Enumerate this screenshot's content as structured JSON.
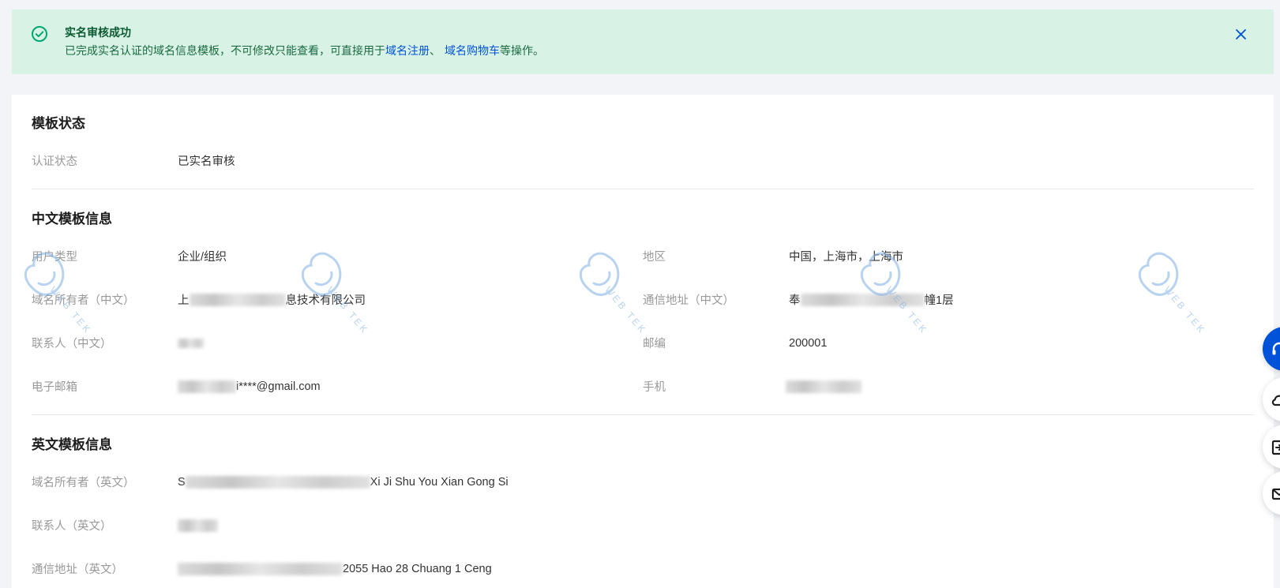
{
  "colors": {
    "page_bg": "#f3f4f7",
    "alert_bg": "#d8f3e5",
    "success": "#00a870",
    "link": "#0052d9",
    "label": "#999999",
    "value": "#333333"
  },
  "alert": {
    "type": "success",
    "icon": "check-circle-icon",
    "title": "实名审核成功",
    "text_before": "已完成实名认证的域名信息模板，不可修改只能查看，可直接用于",
    "link_register": "域名注册",
    "separator": "、",
    "link_cart": "域名购物车",
    "text_after": "等操作。",
    "close_icon": "close-icon"
  },
  "template_status": {
    "title": "模板状态",
    "auth_status": {
      "label": "认证状态",
      "value": "已实名审核"
    }
  },
  "chinese_template": {
    "title": "中文模板信息",
    "user_type": {
      "label": "用户类型",
      "value": "企业/组织"
    },
    "region": {
      "label": "地区",
      "value": "中国，上海市，上海市"
    },
    "owner": {
      "label": "域名所有者（中文）",
      "value_start": "上",
      "value_end": "息技术有限公司"
    },
    "address": {
      "label": "通信地址（中文）",
      "value_start": "奉",
      "value_end": "幢1层"
    },
    "contact": {
      "label": "联系人（中文）"
    },
    "postcode": {
      "label": "邮编",
      "value": "200001"
    },
    "email": {
      "label": "电子邮箱",
      "value_end": "i****@gmail.com"
    },
    "phone": {
      "label": "手机"
    }
  },
  "english_template": {
    "title": "英文模板信息",
    "owner": {
      "label": "域名所有者（英文）",
      "value_start": "S",
      "value_end": "Xi Ji Shu You Xian Gong Si"
    },
    "contact": {
      "label": "联系人（英文）"
    },
    "address": {
      "label": "通信地址（英文）",
      "value_end": "2055 Hao 28 Chuang 1 Ceng"
    }
  },
  "watermark": {
    "text": "WEB TEK",
    "logo_icon": "web-tek-logo-icon"
  },
  "floating_toolbar": {
    "icons": [
      "headset-icon",
      "cloud-icon",
      "document-icon",
      "mail-icon"
    ]
  }
}
